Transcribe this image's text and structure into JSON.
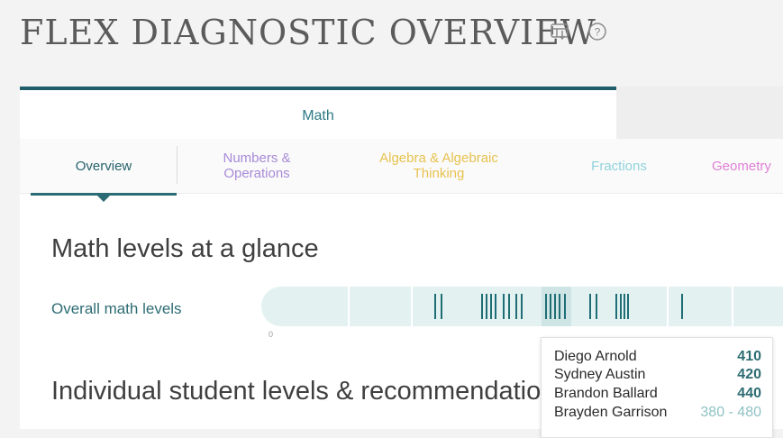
{
  "header": {
    "title": "FLEX DIAGNOSTIC OVERVIEW"
  },
  "icons": {
    "report": "report-download-icon",
    "help": "help-icon"
  },
  "subject_tabs": [
    {
      "label": "Math",
      "active": true
    }
  ],
  "subnav": [
    {
      "label": "Overview",
      "color": "#27626b",
      "active": true
    },
    {
      "label": "Numbers & Operations",
      "color": "#a78ad8"
    },
    {
      "label": "Algebra & Algebraic Thinking",
      "color": "#e7c24f"
    },
    {
      "label": "Fractions",
      "color": "#8fd3dc"
    },
    {
      "label": "Geometry",
      "color": "#e07fd6"
    }
  ],
  "sections": {
    "glance_title": "Math levels at a glance",
    "individual_title": "Individual student levels & recommendations"
  },
  "overall": {
    "label": "Overall math levels",
    "axis_start": "0"
  },
  "tooltip": {
    "rows": [
      {
        "name": "Diego Arnold",
        "value": "410"
      },
      {
        "name": "Sydney Austin",
        "value": "420"
      },
      {
        "name": "Brandon Ballard",
        "value": "440"
      },
      {
        "name": "Brayden Garrison",
        "value": "380 - 480",
        "range": true
      }
    ]
  },
  "colors": {
    "accent": "#1f6e76",
    "track": "#e3f2f1",
    "title": "#5b5b5b"
  }
}
